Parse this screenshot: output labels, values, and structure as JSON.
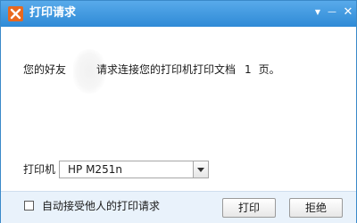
{
  "window": {
    "title": "打印请求",
    "controls": {
      "dropdown_glyph": "▼",
      "minimize_glyph": "—",
      "close_glyph": "✕"
    },
    "app_icon": "qq-app-icon"
  },
  "message": {
    "prefix": "您的好友",
    "middle": "请求连接您的打印机打印文档",
    "page_count": "1",
    "suffix": "页。"
  },
  "printer": {
    "label": "打印机",
    "selected": "HP M251n"
  },
  "footer": {
    "auto_accept_label": "自动接受他人的打印请求",
    "auto_accept_checked": false,
    "print_button": "打印",
    "reject_button": "拒绝"
  },
  "colors": {
    "titlebar": "#3f97df",
    "footer": "#e9f2fb",
    "icon": "#e8681f"
  }
}
